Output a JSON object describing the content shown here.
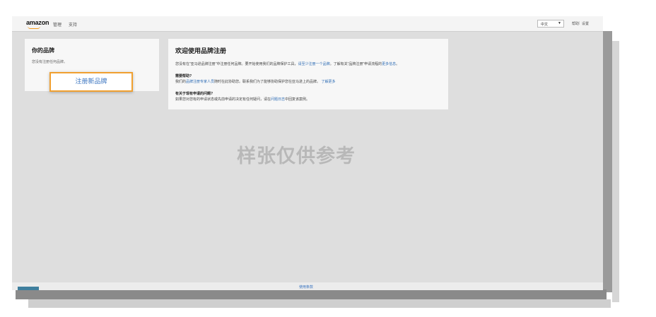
{
  "header": {
    "logo_text": "amazon",
    "nav": [
      "管理",
      "支持"
    ],
    "language": "中文",
    "links": [
      "帮助",
      "设置"
    ],
    "link_separator": "|"
  },
  "brand_panel": {
    "title": "你的品牌",
    "empty_text": "您没有注册任何品牌。",
    "register_button": "注册新品牌"
  },
  "welcome": {
    "title": "欢迎使用品牌注册",
    "intro_text": "您没有在\"亚马逊品牌注册\"中注册任何品牌。要开始使用我们的品牌保护工具，",
    "intro_link": "请至少注册一个品牌",
    "intro_text2": "。了解有关\"品牌注册\"申请流程的",
    "intro_link2": "更多信息",
    "intro_end": "。",
    "help_heading": "需要帮助?",
    "help_text_prefix": "我们的",
    "help_link": "品牌注册专家人员",
    "help_text": "随时在此协助您。联系我们为了能够协助保护您在亚马逊上的品牌。",
    "help_link2": "了解更多",
    "question_heading": "有关于现有申请的问题?",
    "question_text": "如果您对您有的申请状态或先前申请的决定有任何疑问，请在",
    "question_link": "问题日志",
    "question_text2": "中回复该案例。"
  },
  "watermark": "样张仅供参考",
  "footer": {
    "link": "使用条款"
  },
  "colors": {
    "accent_orange": "#f0a030",
    "link_blue": "#2f6db5",
    "footer_tab": "#3f7f9e"
  }
}
